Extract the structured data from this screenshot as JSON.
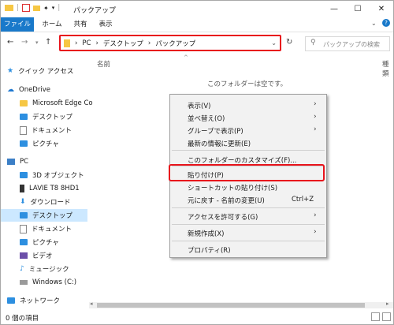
{
  "window": {
    "title": "パックアップ",
    "controls": {
      "minimize": "—",
      "maximize": "☐",
      "close": "✕"
    }
  },
  "ribbon": {
    "tabs": [
      {
        "label": "ファイル"
      },
      {
        "label": "ホーム"
      },
      {
        "label": "共有"
      },
      {
        "label": "表示"
      }
    ]
  },
  "nav": {
    "breadcrumb": [
      "PC",
      "デスクトップ",
      "パックアップ"
    ],
    "search_placeholder": "パックアップの検索"
  },
  "columns": {
    "name": "名前",
    "extra": "種類"
  },
  "content": {
    "empty_text": "このフォルダーは空です。"
  },
  "sidebar": {
    "items": [
      {
        "label": "クイック アクセス",
        "icon": "star-icon"
      },
      {
        "label": "OneDrive",
        "icon": "cloud-icon"
      },
      {
        "label": "Microsoft Edge Co",
        "icon": "folder-icon"
      },
      {
        "label": "デスクトップ",
        "icon": "desktop-icon"
      },
      {
        "label": "ドキュメント",
        "icon": "document-icon"
      },
      {
        "label": "ピクチャ",
        "icon": "pictures-icon"
      },
      {
        "label": "PC",
        "icon": "pc-icon"
      },
      {
        "label": "3D オブジェクト",
        "icon": "3d-objects-icon"
      },
      {
        "label": "LAVIE T8 8HD1",
        "icon": "tablet-icon"
      },
      {
        "label": "ダウンロード",
        "icon": "download-icon"
      },
      {
        "label": "デスクトップ",
        "icon": "desktop-icon"
      },
      {
        "label": "ドキュメント",
        "icon": "document-icon"
      },
      {
        "label": "ピクチャ",
        "icon": "pictures-icon"
      },
      {
        "label": "ビデオ",
        "icon": "video-icon"
      },
      {
        "label": "ミュージック",
        "icon": "music-icon"
      },
      {
        "label": "Windows (C:)",
        "icon": "drive-icon"
      },
      {
        "label": "ネットワーク",
        "icon": "network-icon"
      }
    ]
  },
  "context_menu": {
    "items": [
      {
        "label": "表示(V)",
        "submenu": true
      },
      {
        "label": "並べ替え(O)",
        "submenu": true
      },
      {
        "label": "グループで表示(P)",
        "submenu": true
      },
      {
        "label": "最新の情報に更新(E)"
      },
      {
        "label": "このフォルダーのカスタマイズ(F)..."
      },
      {
        "label": "貼り付け(P)"
      },
      {
        "label": "ショートカットの貼り付け(S)"
      },
      {
        "label": "元に戻す - 名前の変更(U)",
        "shortcut": "Ctrl+Z"
      },
      {
        "label": "アクセスを許可する(G)",
        "submenu": true
      },
      {
        "label": "新規作成(X)",
        "submenu": true
      },
      {
        "label": "プロパティ(R)"
      }
    ]
  },
  "status": {
    "item_count": "0 個の項目"
  },
  "colors": {
    "accent": "#1979ca",
    "highlight": "#e8141c",
    "selection": "#cce8ff"
  }
}
